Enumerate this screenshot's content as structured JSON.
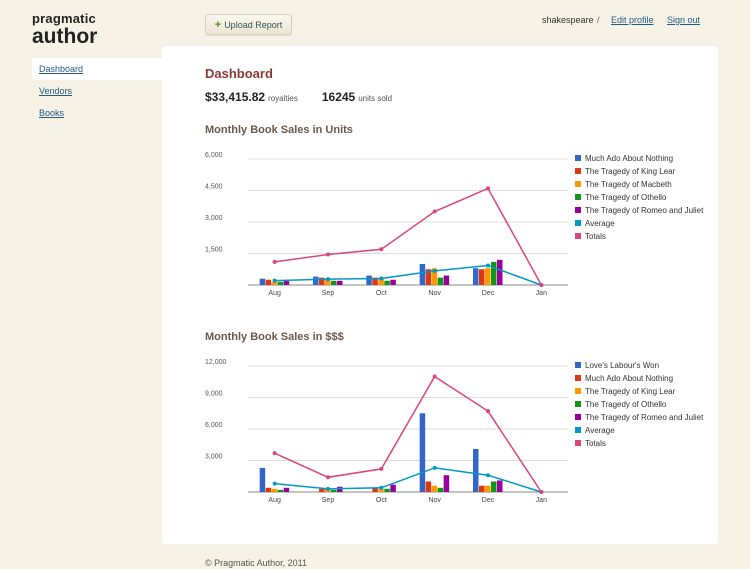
{
  "app": {
    "logo_line1": "pragmatic",
    "logo_line2": "author"
  },
  "toolbar": {
    "upload_label": "Upload Report",
    "upload_icon": "plus-icon"
  },
  "topnav": {
    "username": "shakespeare",
    "separator": "/",
    "edit_profile": "Edit profile",
    "sign_out": "Sign out"
  },
  "sidebar": {
    "items": [
      {
        "label": "Dashboard",
        "active": true
      },
      {
        "label": "Vendors",
        "active": false
      },
      {
        "label": "Books",
        "active": false
      }
    ]
  },
  "main": {
    "title": "Dashboard",
    "royalties_value": "$33,415.82",
    "royalties_label": "royalties",
    "units_value": "16245",
    "units_label": "units sold"
  },
  "colors": {
    "accent_title": "#8a3a33",
    "link": "#235a86"
  },
  "chart_data": [
    {
      "type": "bar",
      "title": "Monthly Book Sales in Units",
      "categories": [
        "Aug",
        "Sep",
        "Oct",
        "Nov",
        "Dec",
        "Jan"
      ],
      "ylim": [
        0,
        6000
      ],
      "yticks": [
        "6,000",
        "4,500",
        "3,000",
        "1,500"
      ],
      "series": [
        {
          "name": "Much Ado About Nothing",
          "kind": "bar",
          "color": "#3366cc",
          "values": [
            300,
            400,
            450,
            1000,
            800,
            0
          ]
        },
        {
          "name": "The Tragedy of King Lear",
          "kind": "bar",
          "color": "#dc3912",
          "values": [
            250,
            350,
            350,
            750,
            750,
            0
          ]
        },
        {
          "name": "The Tragedy of Macbeth",
          "kind": "bar",
          "color": "#ff9900",
          "values": [
            150,
            250,
            300,
            800,
            800,
            0
          ]
        },
        {
          "name": "The Tragedy of Othello",
          "kind": "bar",
          "color": "#109618",
          "values": [
            150,
            200,
            200,
            350,
            1100,
            0
          ]
        },
        {
          "name": "The Tragedy of Romeo and Juliet",
          "kind": "bar",
          "color": "#990099",
          "values": [
            200,
            200,
            250,
            450,
            1200,
            0
          ]
        },
        {
          "name": "Average",
          "kind": "line",
          "color": "#0099c6",
          "values": [
            210,
            280,
            310,
            670,
            930,
            0
          ]
        },
        {
          "name": "Totals",
          "kind": "line",
          "color": "#dd4477",
          "values": [
            1100,
            1450,
            1700,
            3500,
            4600,
            0
          ]
        }
      ]
    },
    {
      "type": "bar",
      "title": "Monthly Book Sales in $$$",
      "categories": [
        "Aug",
        "Sep",
        "Oct",
        "Nov",
        "Dec",
        "Jan"
      ],
      "ylim": [
        0,
        12000
      ],
      "yticks": [
        "12,000",
        "9,000",
        "6,000",
        "3,000"
      ],
      "series": [
        {
          "name": "Love's Labour's Won",
          "kind": "bar",
          "color": "#3366cc",
          "values": [
            2300,
            0,
            0,
            7500,
            4100,
            0
          ]
        },
        {
          "name": "Much Ado About Nothing",
          "kind": "bar",
          "color": "#dc3912",
          "values": [
            400,
            300,
            400,
            1000,
            600,
            0
          ]
        },
        {
          "name": "The Tragedy of King Lear",
          "kind": "bar",
          "color": "#ff9900",
          "values": [
            300,
            300,
            300,
            600,
            600,
            0
          ]
        },
        {
          "name": "The Tragedy of Othello",
          "kind": "bar",
          "color": "#109618",
          "values": [
            200,
            200,
            300,
            400,
            1000,
            0
          ]
        },
        {
          "name": "The Tragedy of Romeo and Juliet",
          "kind": "bar",
          "color": "#990099",
          "values": [
            400,
            500,
            700,
            1600,
            1100,
            0
          ]
        },
        {
          "name": "Average",
          "kind": "line",
          "color": "#0099c6",
          "values": [
            800,
            300,
            400,
            2300,
            1600,
            0
          ]
        },
        {
          "name": "Totals",
          "kind": "line",
          "color": "#dd4477",
          "values": [
            3700,
            1400,
            2200,
            11000,
            7700,
            0
          ]
        }
      ]
    }
  ],
  "footer": {
    "text": "© Pragmatic Author, 2011"
  }
}
